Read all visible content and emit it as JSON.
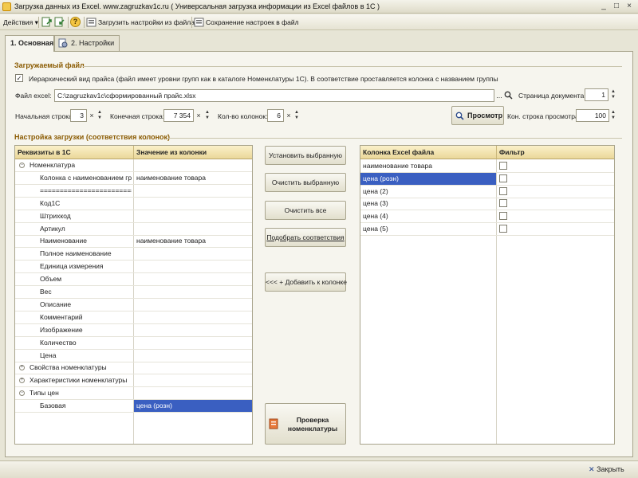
{
  "window": {
    "title": "Загрузка данных из Excel. www.zagruzkav1c.ru ( Универсальная загрузка информации из Excel файлов в 1С )",
    "minimize": "_",
    "maximize": "□",
    "close": "×"
  },
  "toolbar": {
    "actions_label": "Действия ▾",
    "help_label": "?",
    "load_settings_label": "Загрузить настройки из файла",
    "save_settings_label": "Сохранение настроек в файл"
  },
  "tabs": [
    {
      "label": "1. Основная"
    },
    {
      "label": "2. Настройки"
    }
  ],
  "file_group": {
    "title": "Загружаемый файл",
    "hierarchy_checkbox_checked": true,
    "hierarchy_mark": "✓",
    "hierarchy_label": "Иерархический вид прайса (файл имеет уровни групп как в каталоге Номенклатуры 1С). В соответствие проставляется колонка с названием группы",
    "file_label": "Файл excel:",
    "file_value": "C:\\zagruzkav1c\\сформированный прайс.xlsx",
    "browse_label": "...",
    "clear_label": "×",
    "page_label": "Страница документа:",
    "page_value": "1",
    "start_row_label": "Начальная строка:",
    "start_row_value": "3",
    "end_row_label": "Конечная строка:",
    "end_row_value": "7 354",
    "col_count_label": "Кол-во колонок:",
    "col_count_value": "6",
    "preview_button": "Просмотр",
    "preview_end_label": "Кон. строка просмотра:",
    "preview_end_value": "100"
  },
  "mapping_group": {
    "title": "Настройка загрузки (соответствия колонок)",
    "left_table": {
      "col1": "Реквизиты в 1С",
      "col2": "Значение из колонки",
      "rows": [
        {
          "label": "Номенклатура",
          "value": "",
          "toggle": "−",
          "level": 0
        },
        {
          "label": "Колонка с наименованием гр...",
          "value": "наименование товара",
          "toggle": "",
          "level": 1
        },
        {
          "label": "=========================",
          "value": "",
          "toggle": "",
          "level": 1
        },
        {
          "label": "Код1С",
          "value": "",
          "toggle": "",
          "level": 1
        },
        {
          "label": "Штрихкод",
          "value": "",
          "toggle": "",
          "level": 1
        },
        {
          "label": "Артикул",
          "value": "",
          "toggle": "",
          "level": 1
        },
        {
          "label": "Наименование",
          "value": "наименование товара",
          "toggle": "",
          "level": 1
        },
        {
          "label": "Полное наименование",
          "value": "",
          "toggle": "",
          "level": 1
        },
        {
          "label": "Единица измерения",
          "value": "",
          "toggle": "",
          "level": 1
        },
        {
          "label": "Объем",
          "value": "",
          "toggle": "",
          "level": 1
        },
        {
          "label": "Вес",
          "value": "",
          "toggle": "",
          "level": 1
        },
        {
          "label": "Описание",
          "value": "",
          "toggle": "",
          "level": 1
        },
        {
          "label": "Комментарий",
          "value": "",
          "toggle": "",
          "level": 1
        },
        {
          "label": "Изображение",
          "value": "",
          "toggle": "",
          "level": 1
        },
        {
          "label": "Количество",
          "value": "",
          "toggle": "",
          "level": 1
        },
        {
          "label": "Цена",
          "value": "",
          "toggle": "",
          "level": 1
        },
        {
          "label": "Свойства номенклатуры",
          "value": "",
          "toggle": "+",
          "level": 0
        },
        {
          "label": "Характеристики номенклатуры",
          "value": "",
          "toggle": "+",
          "level": 0
        },
        {
          "label": "Типы цен",
          "value": "",
          "toggle": "−",
          "level": 0
        },
        {
          "label": "Базовая",
          "value": "цена (розн)",
          "toggle": "",
          "level": 1,
          "selected_value": true
        }
      ]
    },
    "buttons": {
      "set_selected": "Установить выбранную",
      "clear_selected": "Очистить выбранную",
      "clear_all": "Очистить все",
      "match": "Подобрать соответствия",
      "add_to_column": "<<< + Добавить к колонке",
      "check_line1": "Проверка",
      "check_line2": "номенклатуры"
    },
    "right_table": {
      "col1": "Колонка Excel файла",
      "col2": "Фильтр",
      "rows": [
        {
          "label": "наименование товара",
          "selected": false
        },
        {
          "label": "цена (розн)",
          "selected": true
        },
        {
          "label": "цена (2)",
          "selected": false
        },
        {
          "label": "цена (3)",
          "selected": false
        },
        {
          "label": "цена (4)",
          "selected": false
        },
        {
          "label": "цена (5)",
          "selected": false
        }
      ]
    }
  },
  "footer": {
    "close_label": "Закрыть",
    "close_mark": "✕"
  },
  "colors": {
    "selection": "#3a5fc1",
    "group_title": "#8a5a00"
  }
}
